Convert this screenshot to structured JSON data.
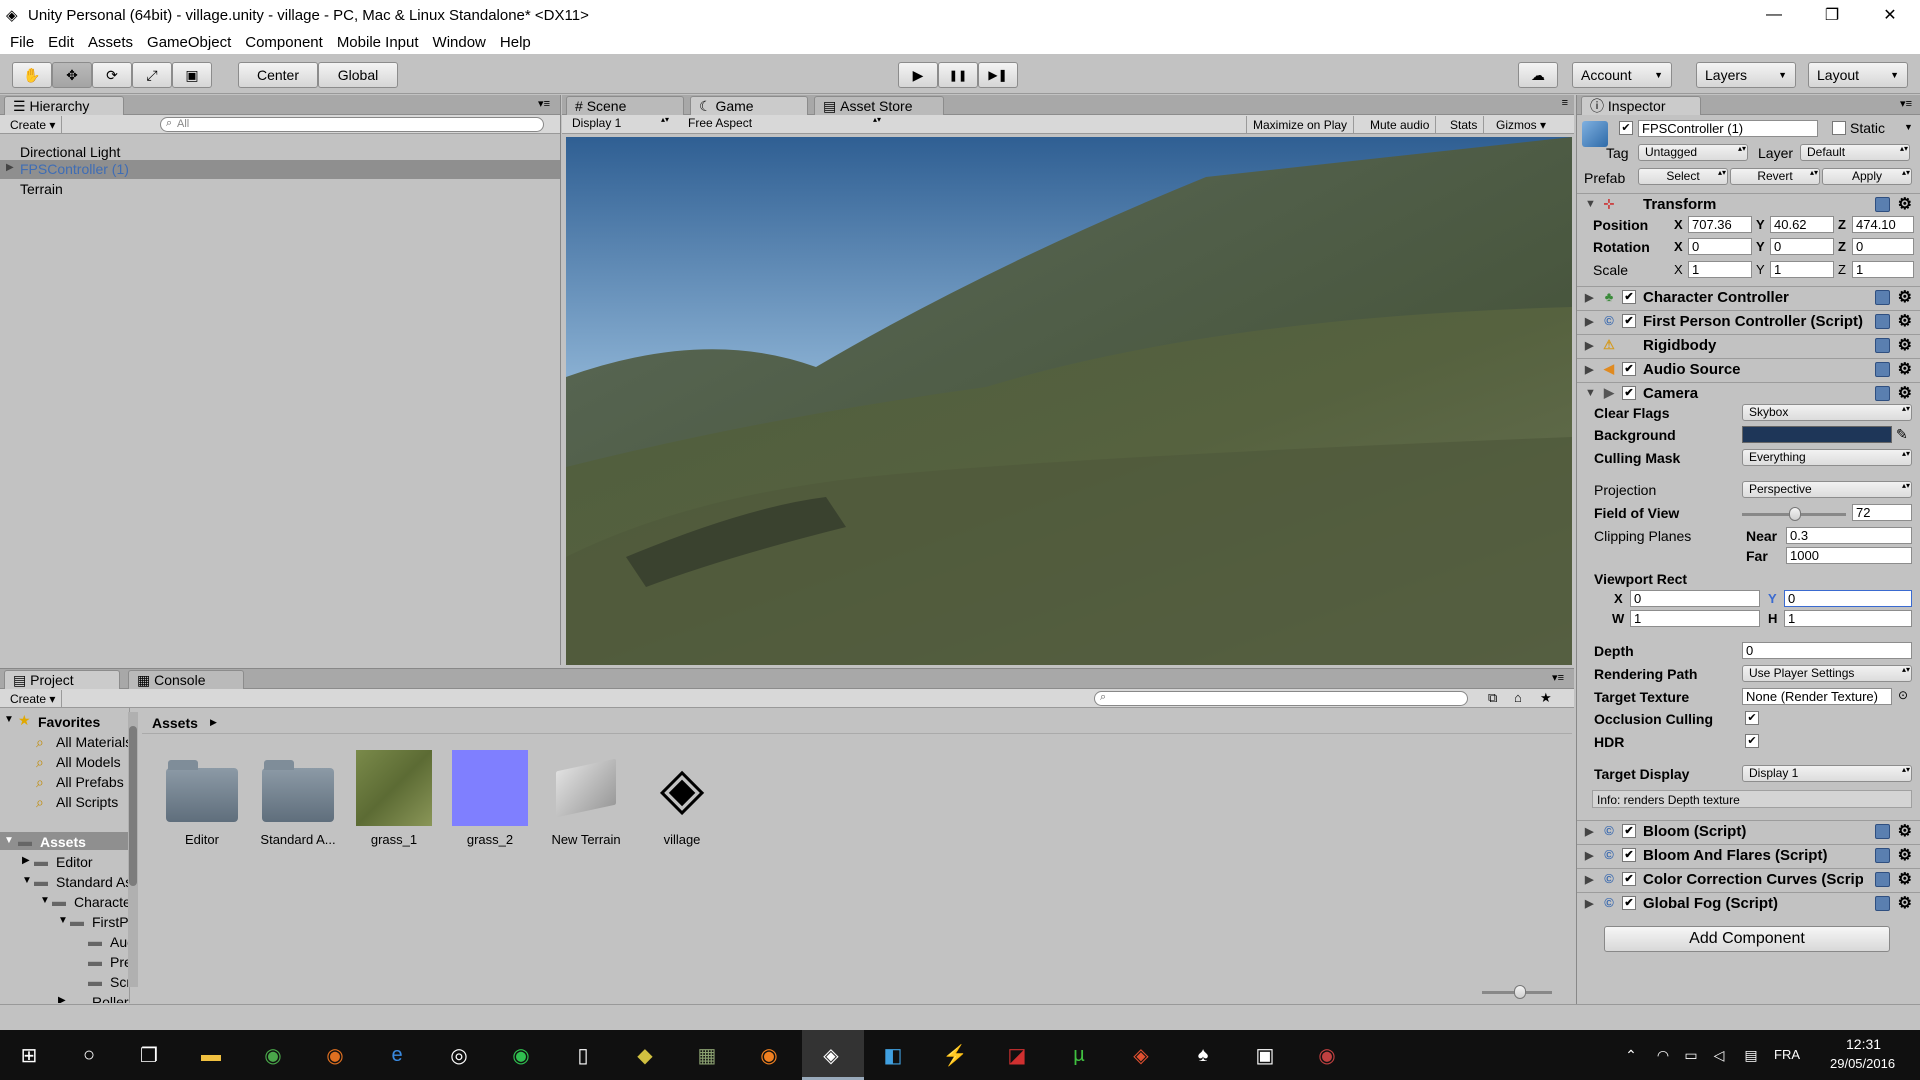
{
  "window": {
    "title": "Unity Personal (64bit) - village.unity - village - PC, Mac & Linux Standalone* <DX11>",
    "minimize": "—",
    "maximize": "❐",
    "close": "✕"
  },
  "menu": [
    "File",
    "Edit",
    "Assets",
    "GameObject",
    "Component",
    "Mobile Input",
    "Window",
    "Help"
  ],
  "toolbar": {
    "pivot": "Center",
    "space": "Global",
    "play": "▶",
    "pause": "❚❚",
    "step": "▶❚",
    "cloud": "☁",
    "account": "Account",
    "layers": "Layers",
    "layout": "Layout"
  },
  "hierarchy": {
    "tab": "Hierarchy",
    "create": "Create",
    "search_placeholder": "All",
    "items": [
      "Directional Light",
      "FPSController (1)",
      "Terrain"
    ]
  },
  "scene_tabs": [
    "Scene",
    "Game",
    "Asset Store"
  ],
  "game_bar": {
    "display": "Display 1",
    "aspect": "Free Aspect",
    "maximize": "Maximize on Play",
    "mute": "Mute audio",
    "stats": "Stats",
    "gizmos": "Gizmos"
  },
  "inspector": {
    "tab": "Inspector",
    "object_name": "FPSController (1)",
    "static": "Static",
    "tag_label": "Tag",
    "tag": "Untagged",
    "layer_label": "Layer",
    "layer": "Default",
    "prefab_label": "Prefab",
    "prefab_select": "Select",
    "prefab_revert": "Revert",
    "prefab_apply": "Apply",
    "transform": {
      "title": "Transform",
      "pos_label": "Position",
      "rot_label": "Rotation",
      "scale_label": "Scale",
      "px": "707.36",
      "py": "40.62",
      "pz": "474.10",
      "rx": "0",
      "ry": "0",
      "rz": "0",
      "sx": "1",
      "sy": "1",
      "sz": "1",
      "X": "X",
      "Y": "Y",
      "Z": "Z"
    },
    "components_top": [
      "Character Controller",
      "First Person Controller (Script)",
      "Rigidbody",
      "Audio Source"
    ],
    "camera": {
      "title": "Camera",
      "clear_flags_label": "Clear Flags",
      "clear_flags": "Skybox",
      "background_label": "Background",
      "background_color": "#1e3658",
      "culling_label": "Culling Mask",
      "culling": "Everything",
      "projection_label": "Projection",
      "projection": "Perspective",
      "fov_label": "Field of View",
      "fov": "72",
      "fov_fraction": 0.49,
      "clipping_label": "Clipping Planes",
      "near_label": "Near",
      "near": "0.3",
      "far_label": "Far",
      "far": "1000",
      "viewport_label": "Viewport Rect",
      "vx": "0",
      "vy": "0",
      "vw": "1",
      "vh": "1",
      "W": "W",
      "H": "H",
      "depth_label": "Depth",
      "depth": "0",
      "rendering_label": "Rendering Path",
      "rendering": "Use Player Settings",
      "target_tex_label": "Target Texture",
      "target_tex": "None (Render Texture)",
      "occlusion_label": "Occlusion Culling",
      "hdr_label": "HDR",
      "target_display_label": "Target Display",
      "target_display": "Display 1",
      "info": "Info: renders Depth texture"
    },
    "components_bottom": [
      "Bloom (Script)",
      "Bloom And Flares (Script)",
      "Color Correction Curves (Script)",
      "Global Fog (Script)"
    ],
    "add_component": "Add Component"
  },
  "project": {
    "tab_project": "Project",
    "tab_console": "Console",
    "create": "Create",
    "breadcrumb": "Assets",
    "favorites_label": "Favorites",
    "favorites": [
      "All Materials",
      "All Models",
      "All Prefabs",
      "All Scripts"
    ],
    "assets_label": "Assets",
    "tree": [
      "Editor",
      "Standard Assets",
      "Characters",
      "FirstPersonCharacter",
      "Audio",
      "Prefabs",
      "Scripts",
      "RollerBall"
    ],
    "assets": [
      "Editor",
      "Standard A...",
      "grass_1",
      "grass_2",
      "New Terrain",
      "village"
    ]
  },
  "taskbar": {
    "time": "12:31",
    "date": "29/05/2016",
    "lang": "FRA"
  }
}
